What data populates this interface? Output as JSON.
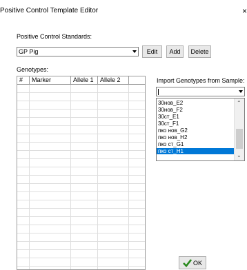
{
  "window": {
    "title": "Positive Control Template Editor",
    "close_glyph": "×"
  },
  "standards": {
    "label": "Positive Control Standards:",
    "selected": "GP Pig",
    "buttons": [
      "Edit",
      "Add",
      "Delete"
    ]
  },
  "genotypes": {
    "label": "Genotypes:",
    "columns": [
      "#",
      "Marker",
      "Allele 1",
      "Allele 2",
      ""
    ]
  },
  "import": {
    "label": "Import Genotypes from Sample:",
    "value": "",
    "items": [
      "30нов_E2",
      "30нов_F2",
      "30ст_E1",
      "30ст_F1",
      "пко нов_G2",
      "пко нов_H2",
      "пко ст_G1",
      "пко ст_H1"
    ],
    "selected_index": 7
  },
  "ok": {
    "label": "OK",
    "icon": "checkmark-icon",
    "icon_color": "#2a8a1e"
  }
}
